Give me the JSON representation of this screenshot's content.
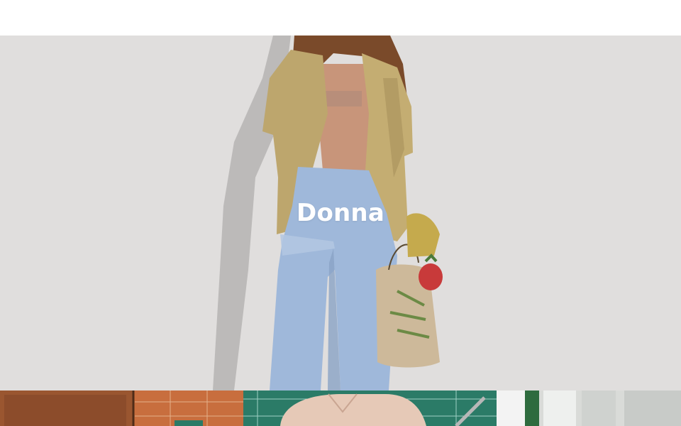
{
  "hero": {
    "title": "Donna",
    "image": "woman-in-khaki-shirt-and-blue-striped-trousers-photo"
  },
  "tiles": [
    {
      "image": "orange-tile-wall-and-wooden-door-photo"
    },
    {
      "image": "green-tiled-wall-with-checked-shirt-photo"
    },
    {
      "image": "white-doorway-with-plants-photo"
    }
  ]
}
